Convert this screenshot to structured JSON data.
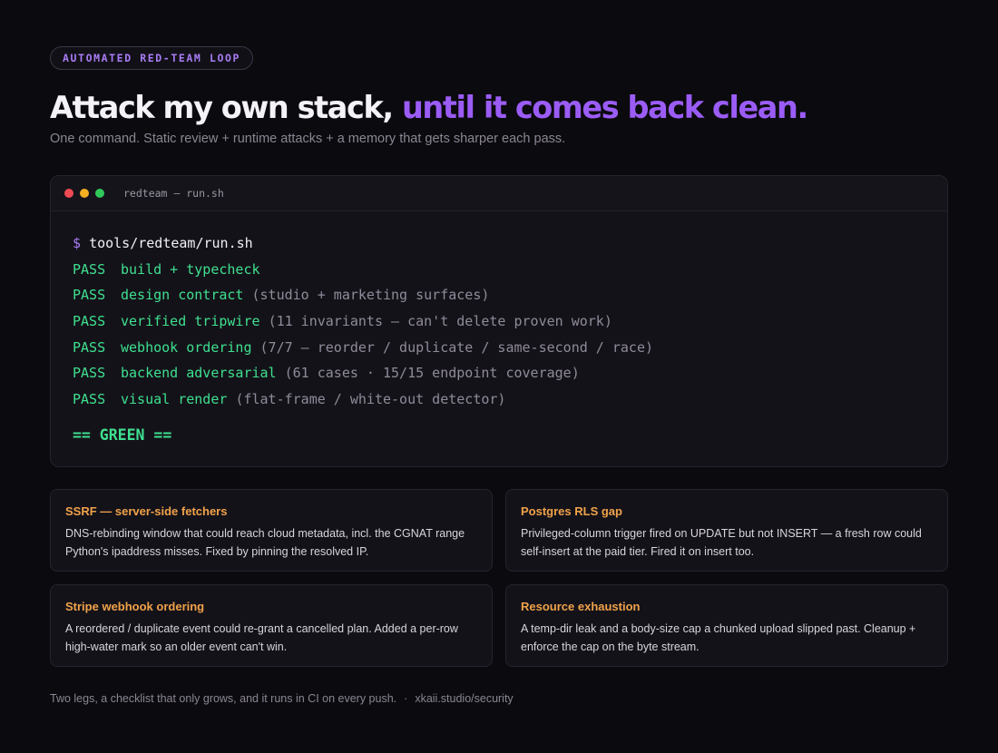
{
  "badge": "AUTOMATED RED-TEAM LOOP",
  "headline": {
    "main": "Attack my own stack,",
    "accent": "until it comes back clean."
  },
  "subtitle": "One command. Static review + runtime attacks + a memory that gets sharper each pass.",
  "terminal": {
    "title": "redteam — run.sh",
    "prompt": "$",
    "command": "tools/redteam/run.sh",
    "lines": [
      {
        "status": "PASS",
        "name": "build + typecheck",
        "detail": ""
      },
      {
        "status": "PASS",
        "name": "design contract",
        "detail": "(studio + marketing surfaces)"
      },
      {
        "status": "PASS",
        "name": "verified tripwire",
        "detail": "(11 invariants — can't delete proven work)"
      },
      {
        "status": "PASS",
        "name": "webhook ordering",
        "detail": "(7/7 — reorder / duplicate / same-second / race)"
      },
      {
        "status": "PASS",
        "name": "backend adversarial",
        "detail": "(61 cases · 15/15 endpoint coverage)"
      },
      {
        "status": "PASS",
        "name": "visual render",
        "detail": "(flat-frame / white-out detector)"
      }
    ],
    "result": "== GREEN =="
  },
  "findings": [
    {
      "title": "SSRF — server-side fetchers",
      "body": "DNS-rebinding window that could reach cloud metadata, incl. the CGNAT range Python's ipaddress misses. Fixed by pinning the resolved IP."
    },
    {
      "title": "Postgres RLS gap",
      "body": "Privileged-column trigger fired on UPDATE but not INSERT — a fresh row could self-insert at the paid tier. Fired it on insert too."
    },
    {
      "title": "Stripe webhook ordering",
      "body": "A reordered / duplicate event could re-grant a cancelled plan. Added a per-row high-water mark so an older event can't win."
    },
    {
      "title": "Resource exhaustion",
      "body": "A temp-dir leak and a body-size cap a chunked upload slipped past. Cleanup + enforce the cap on the byte stream."
    }
  ],
  "footer": {
    "text": "Two legs, a checklist that only grows, and it runs in CI on every push.",
    "separator": "·",
    "link": "xkaii.studio/security"
  },
  "colors": {
    "background": "#0b0a0e",
    "accent": "#9b5cf6",
    "pass": "#3ee08f",
    "finding_title": "#f0a24a"
  }
}
